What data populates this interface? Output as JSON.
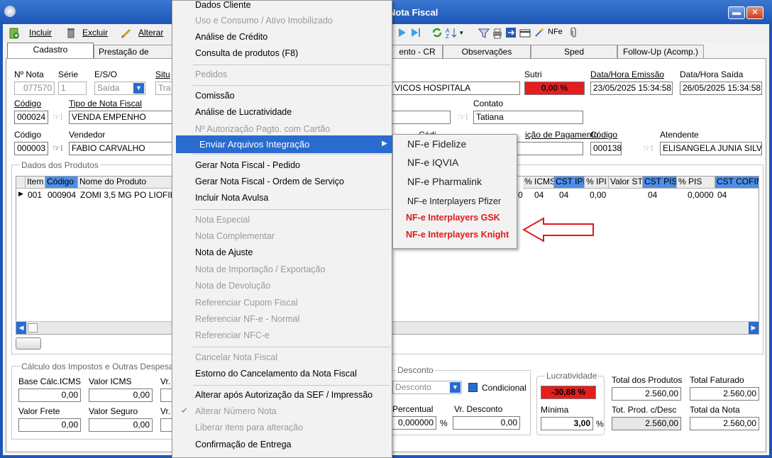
{
  "window": {
    "title": "Nota Fiscal"
  },
  "toolbar": {
    "incluir": "Incluir",
    "excluir": "Excluir",
    "alterar": "Alterar",
    "nfe": "NFe"
  },
  "tabs": [
    "Cadastro",
    "Prestação de Serviço",
    "ento - CR",
    "Observações",
    "Sped",
    "Follow-Up (Acomp.)"
  ],
  "header": {
    "nro_nota_label": "Nº Nota",
    "nro_nota": "077570",
    "serie_label": "Série",
    "serie": "1",
    "esO_label": "E/S/O",
    "eso": "Saída",
    "situ_label": "Situ",
    "situ": "Tra",
    "cliente_nome": "VICOS HOSPITALA",
    "sutri_label": "Sutri",
    "sutri": "0,00 %",
    "data_emissao_label": "Data/Hora Emissão",
    "data_emissao": "23/05/2025 15:34:58",
    "data_saida_label": "Data/Hora Saída",
    "data_saida": "26/05/2025 15:34:58",
    "codigo_label": "Código",
    "codigo": "000024",
    "tipo_nota_label": "Tipo de Nota Fiscal",
    "tipo_nota": "VENDA EMPENHO",
    "contato_label": "Contato",
    "contato": "Tatiana",
    "codigo2_label": "Código",
    "codigo_vend": "000003",
    "vendedor_label": "Vendedor",
    "vendedor": "FABIO CARVALHO",
    "cond_pag_label": "ição de Pagamento",
    "codigo3_label": "Código",
    "codigo3": "000138",
    "atendente_label": "Atendente",
    "atendente": "ELISANGELA JUNIA SILVA",
    "codi_frag": "Códi"
  },
  "produtos": {
    "title": "Dados dos Produtos",
    "columns_left": [
      "Item",
      "Código",
      "Nome do Produto"
    ],
    "columns_right": [
      "% ICMS",
      "CST IPI",
      "% IPI",
      "Valor ST",
      "CST PIS",
      "% PIS",
      "CST COFIN"
    ],
    "row": {
      "item": "001",
      "codigo": "000904",
      "nome": "ZOMI 3,5 MG PO LIOFILI",
      "icms_frag": "0",
      "icms": "04",
      "cst_ipi": "04",
      "ipi": "0,00",
      "valor_st": "",
      "cst_pis": "04",
      "pis": "0,0000",
      "cst_cofins": "04"
    }
  },
  "impostos": {
    "title": "Cálculo dos Impostos e Outras Despesas",
    "base_icms_label": "Base Cálc.ICMS",
    "base_icms": "0,00",
    "valor_icms_label": "Valor ICMS",
    "valor_icms": "0,00",
    "vr_label": "Vr.",
    "vr2_label": "Vr.",
    "valor_frete_label": "Valor Frete",
    "valor_frete": "0,00",
    "valor_seguro_label": "Valor Seguro",
    "valor_seguro": "0,00"
  },
  "desconto": {
    "title": "Desconto",
    "tipo": "Desconto",
    "condicional": "Condicional",
    "percentual_label": "Percentual",
    "percentual": "0,000000",
    "pct_sign": "%",
    "vr_desconto_label": "Vr. Desconto",
    "vr_desconto": "0,00"
  },
  "lucratividade": {
    "title": "Lucratividade",
    "valor": "-30,88 %",
    "minima_label": "Mínima",
    "minima": "3,00",
    "pct_sign": "%"
  },
  "totais": {
    "total_produtos_label": "Total dos Produtos",
    "total_produtos": "2.560,00",
    "total_faturado_label": "Total Faturado",
    "total_faturado": "2.560,00",
    "tot_prod_desc_label": "Tot. Prod. c/Desc",
    "tot_prod_desc": "2.560,00",
    "total_nota_label": "Total da Nota",
    "total_nota": "2.560,00"
  },
  "context_menu": {
    "items": [
      {
        "label": "Dados Cliente",
        "enabled": true
      },
      {
        "label": "Uso e Consumo / Ativo Imobilizado",
        "enabled": false
      },
      {
        "label": "Análise de Crédito",
        "enabled": true
      },
      {
        "label": "Consulta de produtos (F8)",
        "enabled": true
      },
      {
        "label": "Pedidos",
        "enabled": false
      },
      {
        "label": "Comissão",
        "enabled": true
      },
      {
        "label": "Análise de Lucratividade",
        "enabled": true
      },
      {
        "label": "Nº Autorização Pagto. com Cartão",
        "enabled": false
      },
      {
        "label": "Enviar Arquivos Integração",
        "enabled": true
      },
      {
        "label": "Gerar Nota Fiscal - Pedido",
        "enabled": true
      },
      {
        "label": "Gerar Nota Fiscal - Ordem de Serviço",
        "enabled": true
      },
      {
        "label": "Incluir Nota Avulsa",
        "enabled": true
      },
      {
        "label": "Nota Especial",
        "enabled": false
      },
      {
        "label": "Nota Complementar",
        "enabled": false
      },
      {
        "label": "Nota de Ajuste",
        "enabled": true
      },
      {
        "label": "Nota de Importação / Exportação",
        "enabled": false
      },
      {
        "label": "Nota de Devolução",
        "enabled": false
      },
      {
        "label": "Referenciar Cupom Fiscal",
        "enabled": false
      },
      {
        "label": "Referenciar NF-e - Normal",
        "enabled": false
      },
      {
        "label": "Referenciar NFC-e",
        "enabled": false
      },
      {
        "label": "Cancelar Nota Fiscal",
        "enabled": false
      },
      {
        "label": "Estorno do Cancelamento da Nota Fiscal",
        "enabled": true
      },
      {
        "label": "Alterar após Autorização da SEF / Impressão",
        "enabled": true
      },
      {
        "label": "Alterar Número Nota",
        "enabled": false
      },
      {
        "label": "Liberar itens para alteração",
        "enabled": false
      },
      {
        "label": "Confirmação de Entrega",
        "enabled": true
      }
    ]
  },
  "submenu": {
    "items": [
      {
        "label": "NF-e Fidelize"
      },
      {
        "label": "NF-e IQVIA"
      },
      {
        "label": "NF-e Pharmalink"
      },
      {
        "label": "NF-e Interplayers Pfizer"
      },
      {
        "label": "NF-e Interplayers GSK"
      },
      {
        "label": "NF-e Interplayers Knight"
      }
    ]
  },
  "colors": {
    "titlebar": "#1d56b8",
    "menu_highlight": "#2a6bcf",
    "red_value": "#e02020",
    "annot_red": "#e01a1a"
  }
}
